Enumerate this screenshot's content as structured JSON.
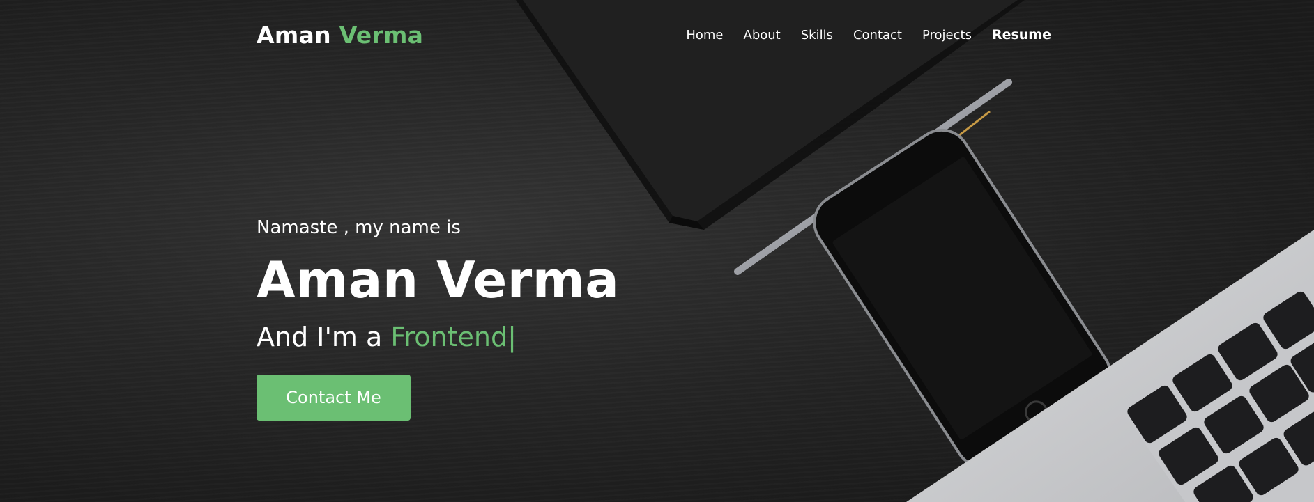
{
  "nav": {
    "brand_first": "Aman",
    "brand_last": "Verma",
    "items": [
      {
        "label": "Home"
      },
      {
        "label": "About"
      },
      {
        "label": "Skills"
      },
      {
        "label": "Contact"
      },
      {
        "label": "Projects"
      },
      {
        "label": "Resume"
      }
    ]
  },
  "hero": {
    "greeting": "Namaste , my name is",
    "name": "Aman Verma",
    "role_prefix": "And I'm a ",
    "role_typed": "Frontend",
    "cursor": "|",
    "cta_label": "Contact Me"
  },
  "colors": {
    "accent": "#6bbf73",
    "text": "#ffffff",
    "background": "#1f1f1f"
  },
  "background_image": "dark wooden desk with notebook, pen, smartphone and laptop"
}
